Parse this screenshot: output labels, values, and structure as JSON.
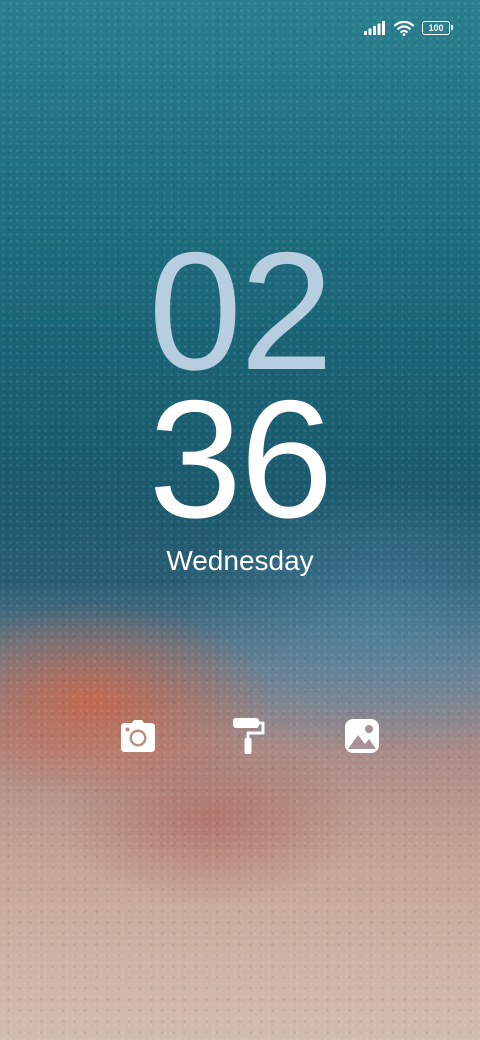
{
  "status_bar": {
    "signal_icon": "signal-bars-icon",
    "wifi_icon": "wifi-icon",
    "battery_level": "100"
  },
  "clock": {
    "hour": "02",
    "minute": "36",
    "day": "Wednesday"
  },
  "shortcuts": {
    "camera_icon": "camera-icon",
    "theme_icon": "paint-roller-icon",
    "gallery_icon": "gallery-icon"
  },
  "colors": {
    "hour": "#b7cde0",
    "minute": "#ffffff",
    "icons": "#ffffff"
  }
}
